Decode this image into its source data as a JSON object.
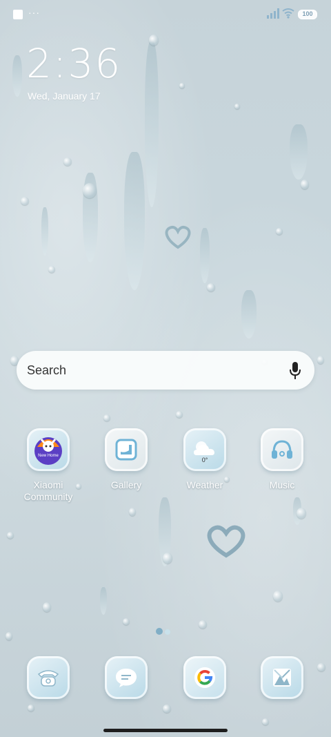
{
  "status_bar": {
    "dots": "···",
    "battery": "100"
  },
  "clock": {
    "time": "2:36",
    "date": "Wed, January 17"
  },
  "search": {
    "label": "Search"
  },
  "apps": [
    {
      "label": "Xiaomi Community",
      "icon": "xiaomi-community-icon",
      "badge_text": "New Home"
    },
    {
      "label": "Gallery",
      "icon": "gallery-icon"
    },
    {
      "label": "Weather",
      "icon": "weather-icon",
      "temp": "0°"
    },
    {
      "label": "Music",
      "icon": "music-headphones-icon"
    }
  ],
  "dock": [
    {
      "icon": "phone-icon"
    },
    {
      "icon": "messages-icon"
    },
    {
      "icon": "google-icon"
    },
    {
      "icon": "gallery-camera-icon"
    }
  ],
  "colors": {
    "accent": "#7fb6d0",
    "icon_bg": "#cbe4ef",
    "text": "#ffffff"
  }
}
